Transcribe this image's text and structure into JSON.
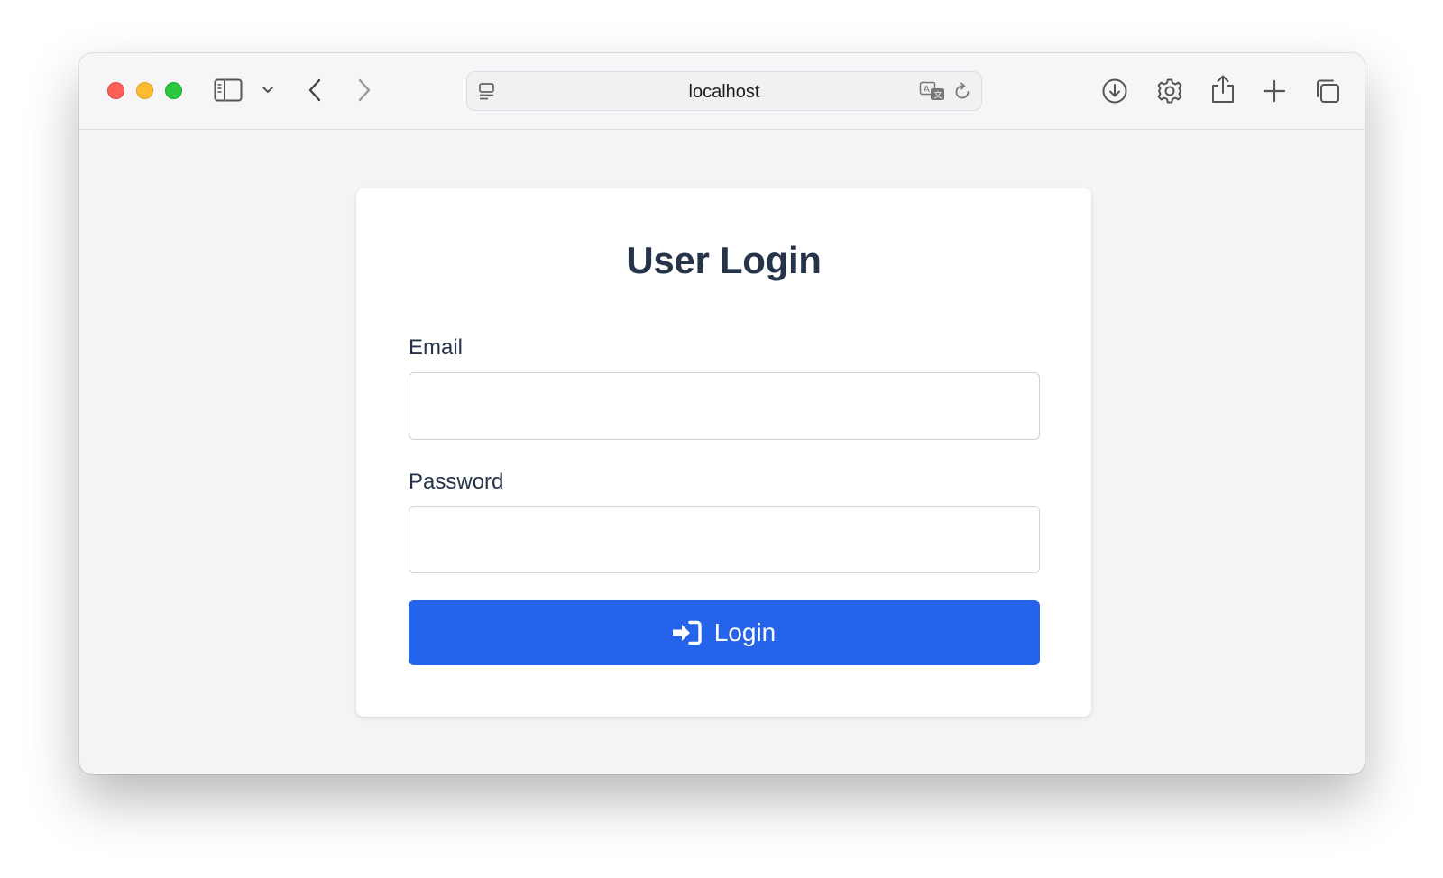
{
  "browser": {
    "url": "localhost",
    "icons": {
      "sidebar": "sidebar-icon",
      "sidebar_menu": "chevron-down-icon",
      "back": "chevron-left-icon",
      "forward": "chevron-right-icon",
      "page_menu": "page-menu-icon",
      "translate": "translate-icon",
      "reload": "reload-icon",
      "downloads": "download-icon",
      "settings": "gear-icon",
      "share": "share-icon",
      "new_tab": "plus-icon",
      "tab_overview": "tabs-icon"
    }
  },
  "login": {
    "title": "User Login",
    "email_label": "Email",
    "email_value": "",
    "password_label": "Password",
    "password_value": "",
    "button_label": "Login",
    "button_icon": "sign-in-icon"
  },
  "colors": {
    "accent": "#2563eb",
    "page_background": "#f3f4f6",
    "card_background": "#ffffff",
    "text": "#263449"
  }
}
